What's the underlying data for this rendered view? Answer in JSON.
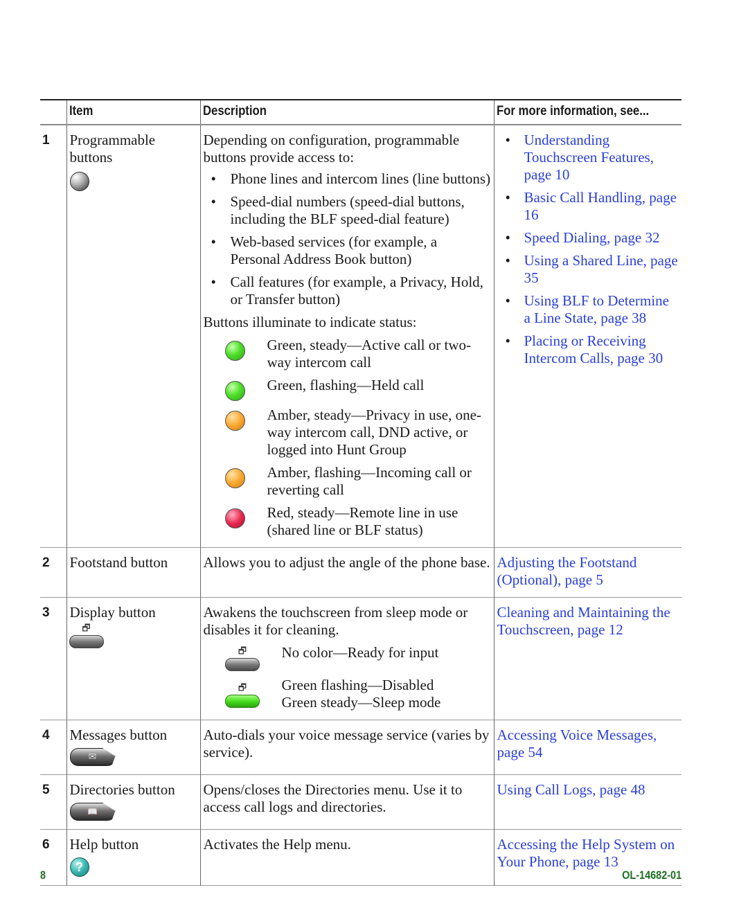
{
  "table": {
    "headers": [
      "",
      "Item",
      "Description",
      "For more information, see..."
    ],
    "rows": [
      {
        "num": "1",
        "item": "Programmable buttons",
        "icon": "programmable-button-icon",
        "desc_intro": "Depending on configuration, programmable buttons provide access to:",
        "desc_bullets": [
          "Phone lines and intercom lines (line buttons)",
          "Speed-dial numbers (speed-dial buttons, including the BLF speed-dial feature)",
          "Web-based services (for example, a Personal Address Book button)",
          "Call features (for example, a Privacy, Hold, or Transfer button)"
        ],
        "desc_status_intro": "Buttons illuminate to indicate status:",
        "status": [
          {
            "color": "green",
            "hex": "#4fe02a",
            "text": "Green, steady—Active call or two-way intercom call"
          },
          {
            "color": "green",
            "hex": "#4fe02a",
            "text": "Green, flashing—Held call"
          },
          {
            "color": "amber",
            "hex": "#f8a830",
            "text": "Amber, steady—Privacy in use, one-way intercom call, DND active, or logged into Hunt Group"
          },
          {
            "color": "amber",
            "hex": "#f8a830",
            "text": "Amber, flashing—Incoming call or reverting call"
          },
          {
            "color": "red",
            "hex": "#e82850",
            "text": "Red, steady—Remote line in use (shared line or BLF status)"
          }
        ],
        "more": [
          "Understanding Touchscreen Features, page 10",
          "Basic Call Handling, page 16",
          "Speed Dialing, page 32",
          "Using a Shared Line, page 35",
          "Using BLF to Determine a Line State, page 38",
          "Placing or Receiving Intercom Calls, page 30"
        ]
      },
      {
        "num": "2",
        "item": "Footstand button",
        "desc": "Allows you to adjust the angle of the phone base.",
        "more": "Adjusting the Footstand (Optional), page 5"
      },
      {
        "num": "3",
        "item": "Display button",
        "icon": "display-button-icon",
        "desc": "Awakens the touchscreen from sleep mode or disables it for cleaning.",
        "states": [
          {
            "color": "gray",
            "text": "No color—Ready for input"
          },
          {
            "color": "green",
            "hex": "#3fd91a",
            "text": "Green flashing—Disabled\nGreen steady—Sleep mode"
          }
        ],
        "more": "Cleaning and Maintaining the Touchscreen, page 12"
      },
      {
        "num": "4",
        "item": "Messages button",
        "icon": "envelope-icon",
        "desc": "Auto-dials your voice message service (varies by service).",
        "more": "Accessing Voice Messages, page 54"
      },
      {
        "num": "5",
        "item": "Directories button",
        "icon": "book-icon",
        "desc": "Opens/closes the Directories menu. Use it to access call logs and directories.",
        "more": "Using Call Logs, page 48"
      },
      {
        "num": "6",
        "item": "Help button",
        "icon": "help-icon",
        "desc": "Activates the Help menu.",
        "more": "Accessing the Help System on Your Phone, page 13"
      }
    ]
  },
  "glyphs": {
    "display": "🗗",
    "envelope": "✉",
    "book": "📖",
    "help": "?"
  },
  "footer": {
    "page_number": "8",
    "doc_id": "OL-14682-01"
  },
  "colors": {
    "link": "#2a3fd6",
    "footer": "#1e6e22"
  }
}
